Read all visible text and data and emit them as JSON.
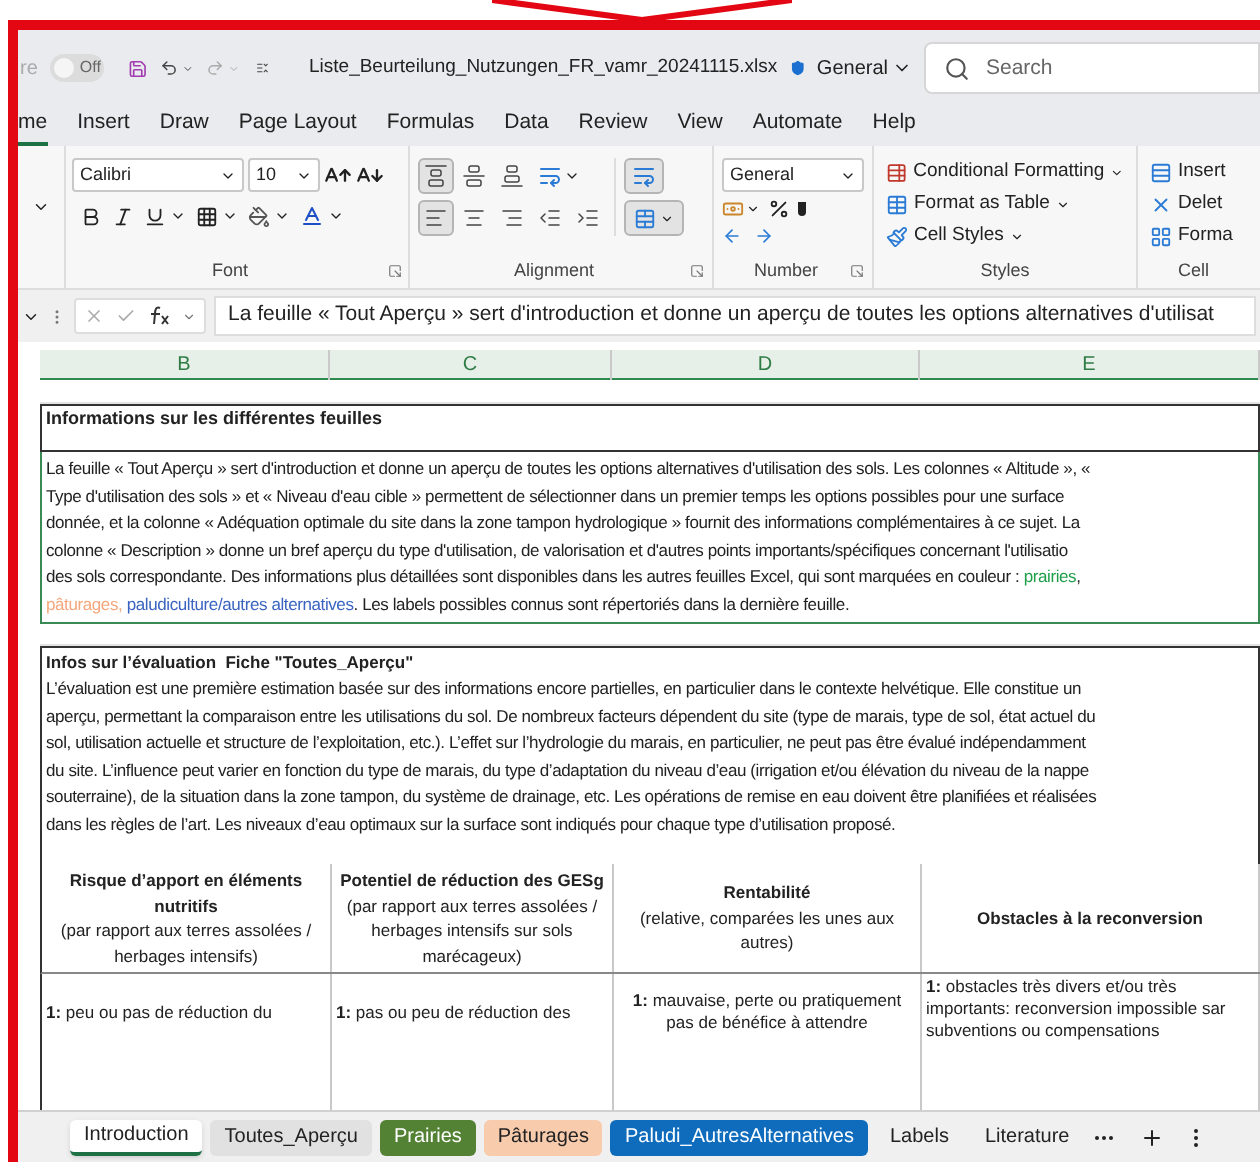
{
  "quick_access": {
    "autosave_label": "re",
    "autosave": {
      "label": "Off",
      "on": false
    }
  },
  "window": {
    "title": "Liste_Beurteilung_Nutzungen_FR_vamr_20241115.xlsx",
    "sensitivity": "General"
  },
  "search": {
    "placeholder": "Search"
  },
  "menu_tabs": [
    {
      "label": "me",
      "selected": true
    },
    {
      "label": "Insert",
      "selected": false
    },
    {
      "label": "Draw",
      "selected": false
    },
    {
      "label": "Page Layout",
      "selected": false
    },
    {
      "label": "Formulas",
      "selected": false
    },
    {
      "label": "Data",
      "selected": false
    },
    {
      "label": "Review",
      "selected": false
    },
    {
      "label": "View",
      "selected": false
    },
    {
      "label": "Automate",
      "selected": false
    },
    {
      "label": "Help",
      "selected": false
    }
  ],
  "ribbon": {
    "font": {
      "name": "Calibri",
      "size": "10",
      "label": "Font"
    },
    "alignment": {
      "label": "Alignment",
      "buttons": [
        {
          "kind": "top",
          "selected": true
        },
        {
          "kind": "middle",
          "selected": false
        },
        {
          "kind": "bottom",
          "selected": false
        },
        {
          "kind": "left",
          "selected": true
        },
        {
          "kind": "center",
          "selected": false
        },
        {
          "kind": "right",
          "selected": false
        },
        {
          "kind": "outdent",
          "selected": false
        },
        {
          "kind": "indent",
          "selected": false
        }
      ],
      "wrap": {
        "selected": true
      },
      "merge": {
        "selected": true
      }
    },
    "number": {
      "format": "General",
      "label": "Number"
    },
    "styles": {
      "label": "Styles",
      "items": [
        "Conditional Formatting",
        "Format as Table",
        "Cell Styles"
      ]
    },
    "cells": {
      "label": "Cell",
      "items": [
        "Insert",
        "Delet",
        "Forma"
      ]
    }
  },
  "formula_bar": {
    "value": "La feuille « Tout Aperçu » sert d'introduction et donne un aperçu de toutes les options alternatives d'utilisat"
  },
  "columns": [
    "B",
    "C",
    "D",
    "E"
  ],
  "info_box": {
    "title": "Informations sur les différentes feuilles",
    "lines": [
      [
        {
          "text": "La feuille « Tout Aperçu » sert d'introduction et donne un aperçu de toutes les options alternatives d'utilisation des sols. Les colonnes « Altitude », «"
        }
      ],
      [
        {
          "text": "Type d'utilisation des sols » et « Niveau d'eau cible » permettent de sélectionner dans un premier temps les options possibles pour une surface"
        }
      ],
      [
        {
          "text": "donnée, et la colonne « Adéquation optimale du site dans la zone tampon hydrologique » fournit des informations complémentaires à ce sujet. La"
        }
      ],
      [
        {
          "text": "colonne « Description » donne un bref aperçu du type d'utilisation, de valorisation et d'autres points importants/spécifiques concernant l'utilisatio"
        }
      ],
      [
        {
          "text": "des sols correspondante. Des informations plus détaillées sont disponibles dans les autres feuilles Excel, qui sont marquées en couleur : "
        },
        {
          "text": "prairies",
          "color": "#1f9e4a"
        },
        {
          "text": ","
        }
      ],
      [
        {
          "text": "pâturages, ",
          "color": "#f4a77c"
        },
        {
          "text": "paludiculture/autres alternatives",
          "color": "#3a64c0"
        },
        {
          "text": ". Les labels possibles connus sont répertoriés dans la dernière feuille."
        }
      ]
    ]
  },
  "evaluation_box": {
    "title": "Infos sur l’évaluation  Fiche \"Toutes_Aperçu\"",
    "lines": [
      "L’évaluation est une première estimation basée sur des informations encore partielles, en particulier dans le contexte helvétique. Elle constitue un",
      "aperçu, permettant la comparaison entre les utilisations du sol. De nombreux facteurs dépendent du site (type de marais, type de sol, état actuel du",
      "sol, utilisation actuelle et structure de l’exploitation, etc.). L’effet sur l’hydrologie du marais, en particulier, ne peut pas être évalué indépendamment",
      "du site. L’influence peut varier en fonction du type de marais, du type d’adaptation du niveau d’eau (irrigation et/ou élévation du niveau de la nappe",
      "souterraine), de la situation dans la zone tampon, du système de drainage, etc. Les opérations de remise en eau doivent être planifiées et réalisées",
      "dans les règles de l’art. Les niveaux d’eau optimaux sur la surface sont indiqués pour chaque type d’utilisation proposé."
    ]
  },
  "table": {
    "headers": [
      {
        "title": "Risque d’apport en éléments nutritifs",
        "subtitle": "(par rapport aux terres assolées / herbages intensifs)"
      },
      {
        "title": "Potentiel de réduction des GESg",
        "subtitle": "(par rapport aux terres assolées / herbages intensifs sur sols marécageux)"
      },
      {
        "title": "Rentabilité",
        "subtitle": "(relative, comparées les unes aux autres)"
      },
      {
        "title": "Obstacles à la reconversion"
      }
    ],
    "rows": [
      [
        [
          "**1:** peu ou pas de réduction du"
        ],
        [
          "**1:** pas ou peu de réduction des"
        ],
        [
          "**1:** mauvaise, perte ou pratiquement",
          "pas de bénéfice à attendre"
        ],
        [
          "**1:** obstacles très divers et/ou très",
          "importants: reconversion impossible sar",
          "subventions ou compensations"
        ]
      ]
    ]
  },
  "sheet_tabs": [
    {
      "label": "Introduction",
      "selected": true
    },
    {
      "label": "Toutes_Aperçu",
      "selected": false,
      "color": "#e1e1e1"
    },
    {
      "label": "Prairies",
      "selected": false,
      "color": "#548235"
    },
    {
      "label": "Pâturages",
      "selected": false,
      "color": "#f8cbad"
    },
    {
      "label": "Paludi_AutresAlternatives",
      "selected": false,
      "color": "#0f6cbd"
    },
    {
      "label": "Labels",
      "selected": false
    },
    {
      "label": "Literature",
      "selected": false
    }
  ]
}
